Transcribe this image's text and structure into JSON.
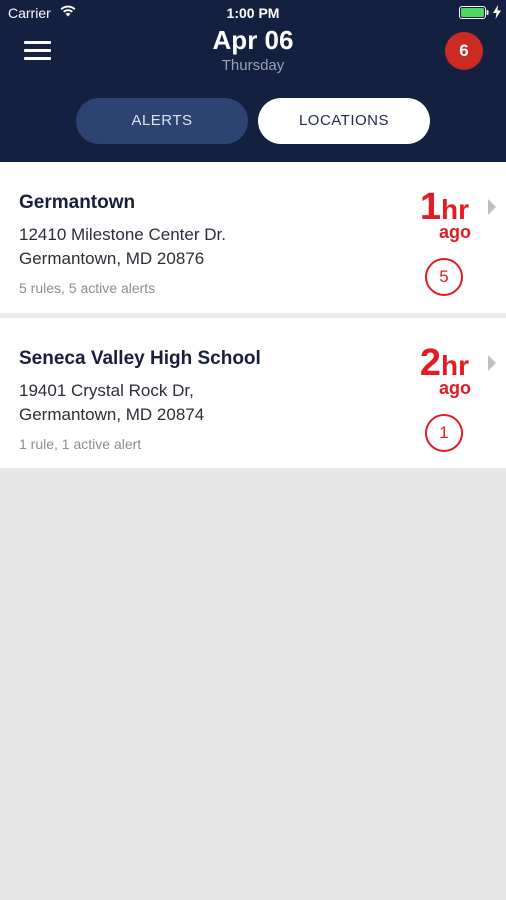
{
  "status_bar": {
    "carrier": "Carrier",
    "time": "1:00 PM",
    "icons": [
      "wifi-icon",
      "battery-icon",
      "bolt-icon"
    ]
  },
  "header": {
    "date": "Apr 06",
    "day": "Thursday",
    "notification_count": "6",
    "menu_icon": "menu-icon"
  },
  "tabs": [
    {
      "label": "ALERTS",
      "active": true
    },
    {
      "label": "LOCATIONS",
      "active": false
    }
  ],
  "alerts": [
    {
      "name": "Germantown",
      "address_line1": "12410 Milestone Center Dr.",
      "address_line2": "Germantown, MD 20876",
      "summary": "5 rules, 5 active alerts",
      "time_num": "1",
      "time_unit": "hr",
      "time_suffix": "ago",
      "count": "5"
    },
    {
      "name": "Seneca Valley High School",
      "address_line1": "19401 Crystal Rock Dr,",
      "address_line2": "Germantown, MD 20874",
      "summary": "1 rule, 1 active alert",
      "time_num": "2",
      "time_unit": "hr",
      "time_suffix": "ago",
      "count": "1"
    }
  ],
  "colors": {
    "header_bg": "#142040",
    "active_tab": "#2d4371",
    "alert_red": "#e31b23",
    "badge_red": "#cc2b24",
    "battery_green": "#4cd964",
    "page_bg": "#e6e6e6"
  }
}
